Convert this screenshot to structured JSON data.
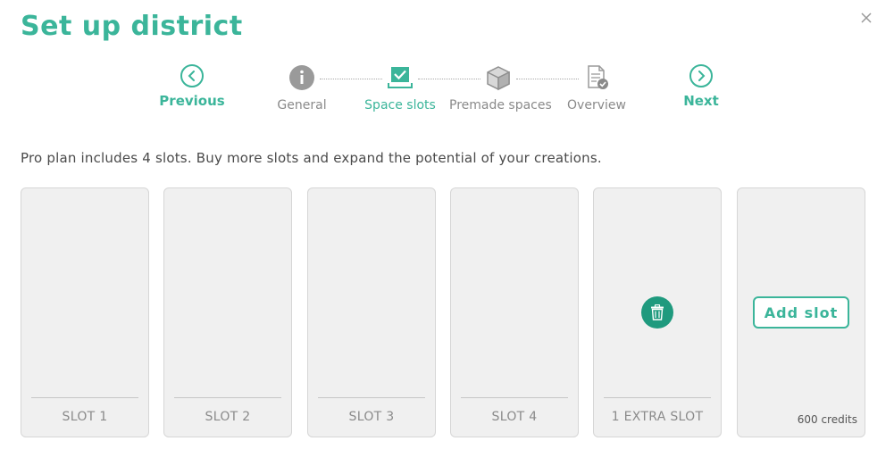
{
  "title": "Set up district",
  "nav": {
    "previous_label": "Previous",
    "next_label": "Next"
  },
  "steps": [
    {
      "label": "General",
      "icon": "info-icon",
      "active": false
    },
    {
      "label": "Space slots",
      "icon": "space-slots-icon",
      "active": true
    },
    {
      "label": "Premade spaces",
      "icon": "cube-icon",
      "active": false
    },
    {
      "label": "Overview",
      "icon": "document-check-icon",
      "active": false
    }
  ],
  "intro_text": "Pro plan includes 4 slots. Buy more slots and expand the potential of your creations.",
  "slots": [
    {
      "label": "SLOT 1"
    },
    {
      "label": "SLOT 2"
    },
    {
      "label": "SLOT 3"
    },
    {
      "label": "SLOT 4"
    },
    {
      "label": "1 EXTRA SLOT",
      "deletable": true
    }
  ],
  "add_slot": {
    "button_label": "Add slot",
    "price": "600 credits"
  },
  "colors": {
    "accent": "#3bb59a",
    "accent_dark": "#1f9a7e",
    "slot_bg": "#f0f0f0",
    "muted": "#8a8a8a"
  }
}
